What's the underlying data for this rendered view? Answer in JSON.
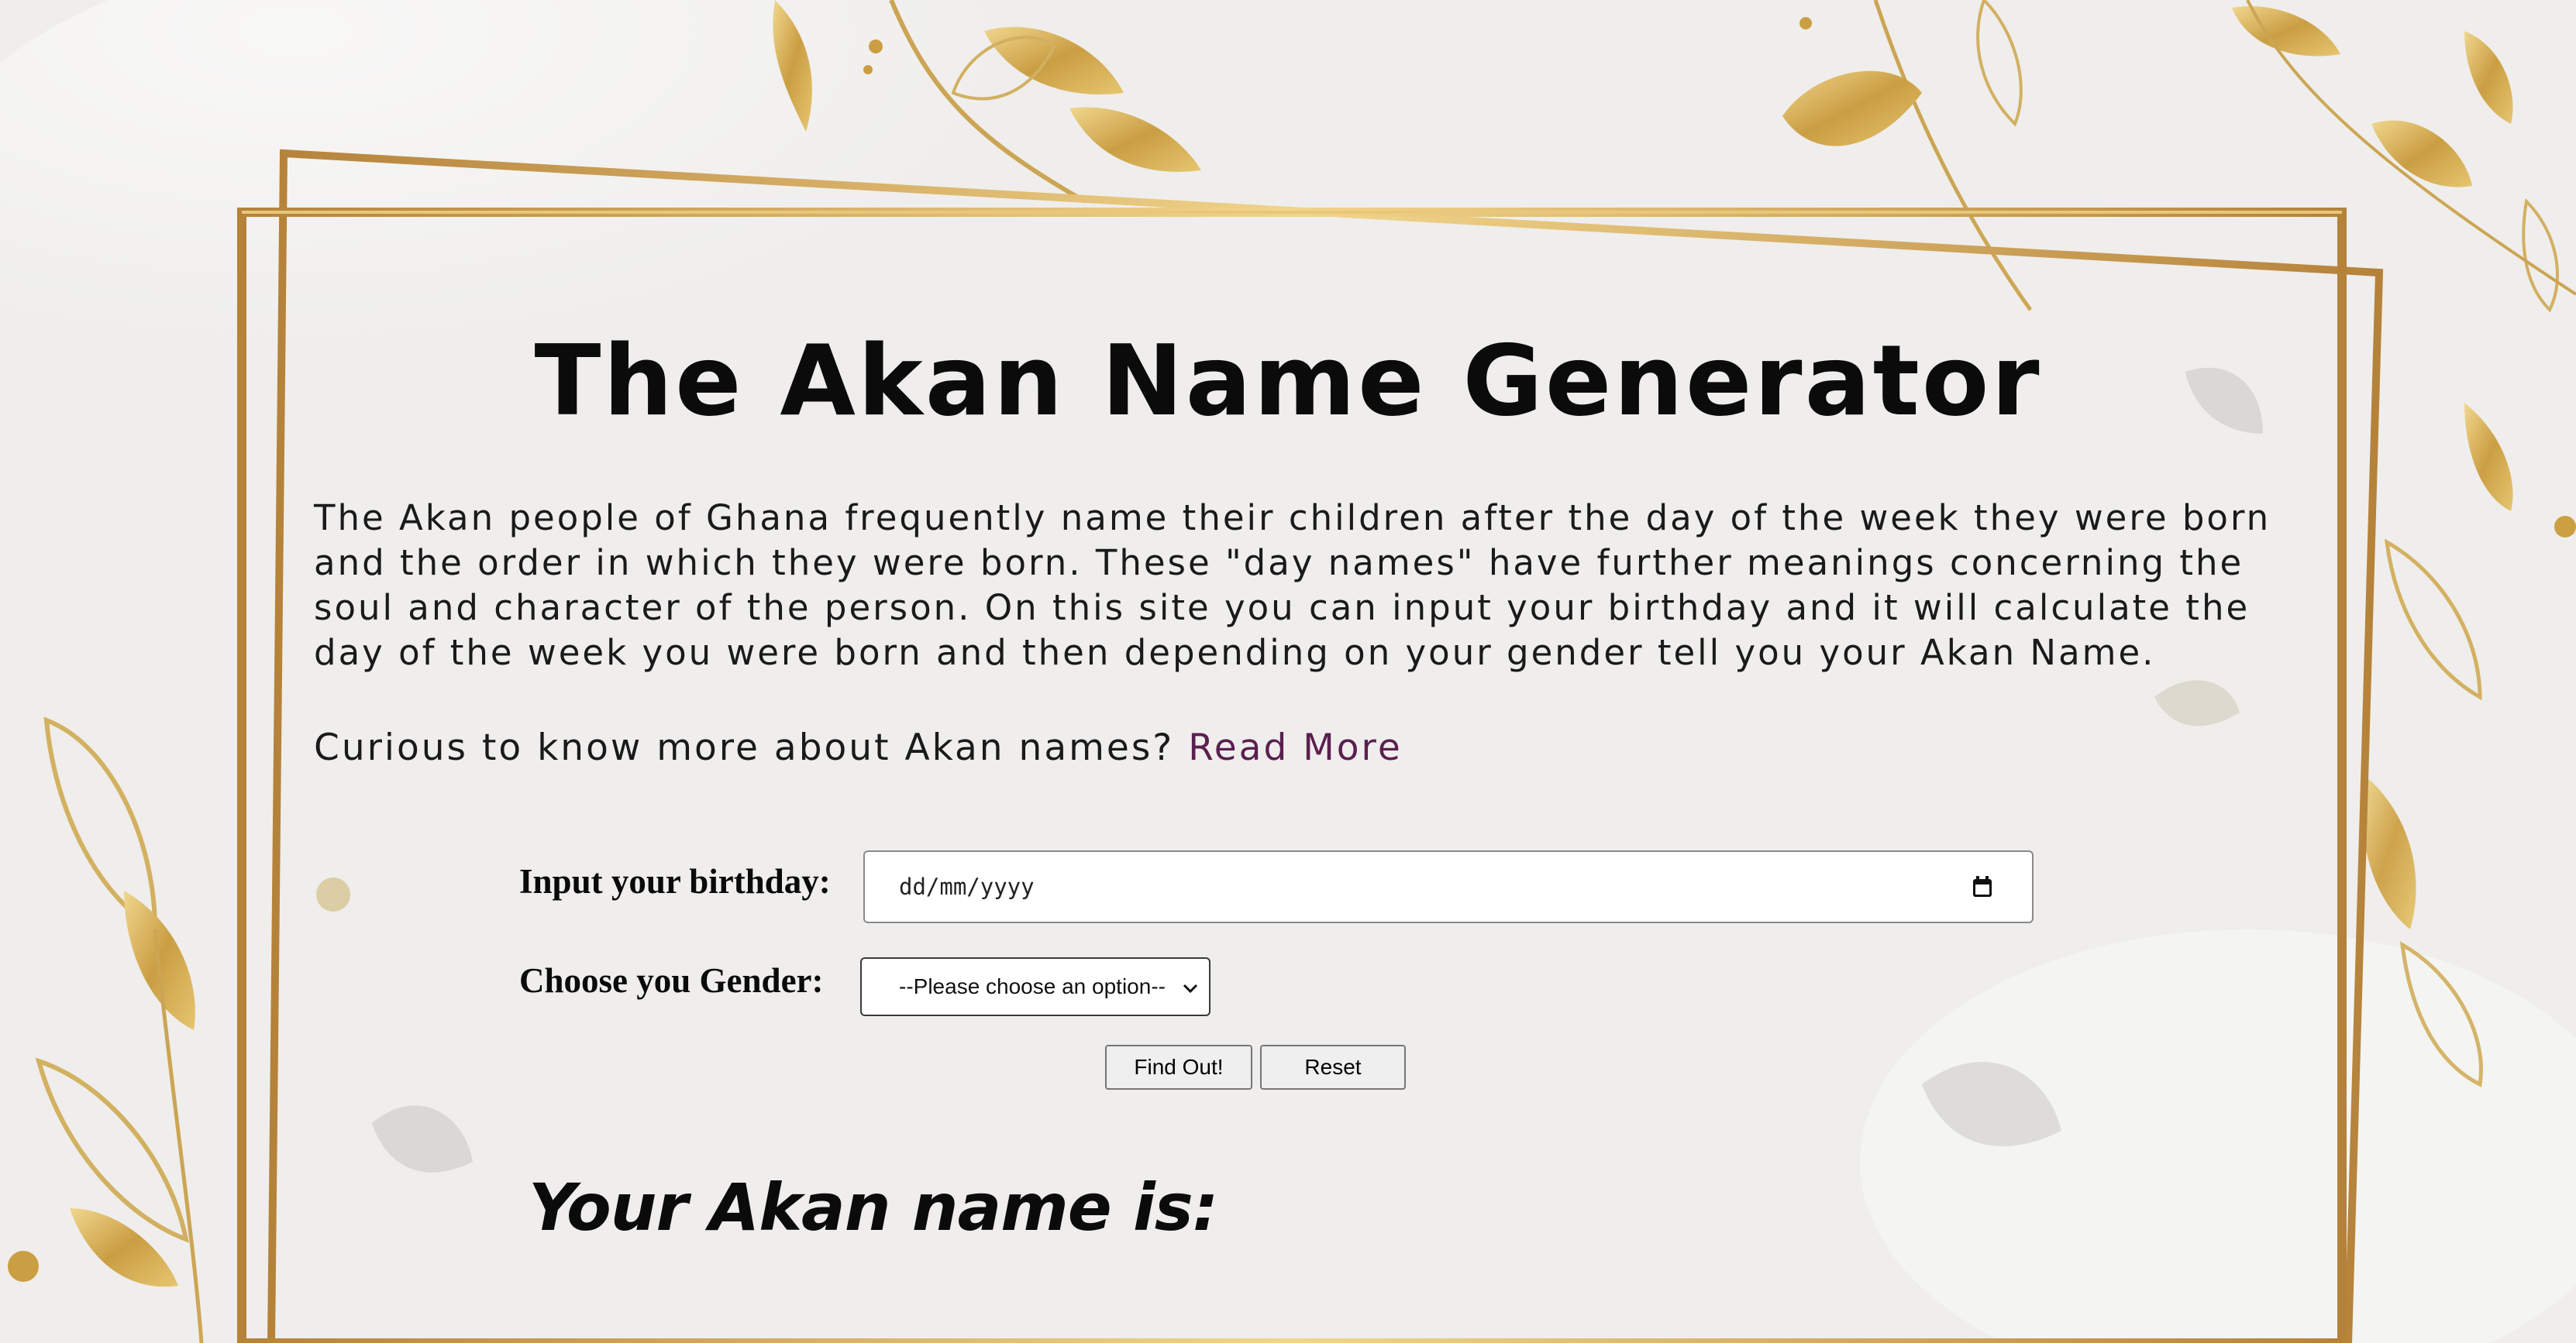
{
  "page": {
    "title": "The Akan Name Generator",
    "intro": "The Akan people of Ghana frequently name their children after the day of the week they were born and the order in which they were born. These \"day names\" have further meanings concerning the soul and character of the person. On this site you can input your birthday and it will calculate the day of the week you were born and then depending on your gender tell you your Akan Name.",
    "curious_text": "Curious to know more about Akan names?",
    "read_more_label": "Read More"
  },
  "form": {
    "birthday_label": "Input your birthday:",
    "birthday_placeholder": "dd/mm/yyyy",
    "gender_label": "Choose you Gender:",
    "gender_selected": "--Please choose an option--",
    "find_out_label": "Find Out!",
    "reset_label": "Reset"
  },
  "result": {
    "label": "Your Akan name is:"
  },
  "colors": {
    "gold": "#c9962f",
    "link": "#5b1f4f",
    "background": "#efeeec"
  },
  "icons": {
    "calendar": "calendar-icon",
    "dropdown": "chevron-down-icon"
  }
}
